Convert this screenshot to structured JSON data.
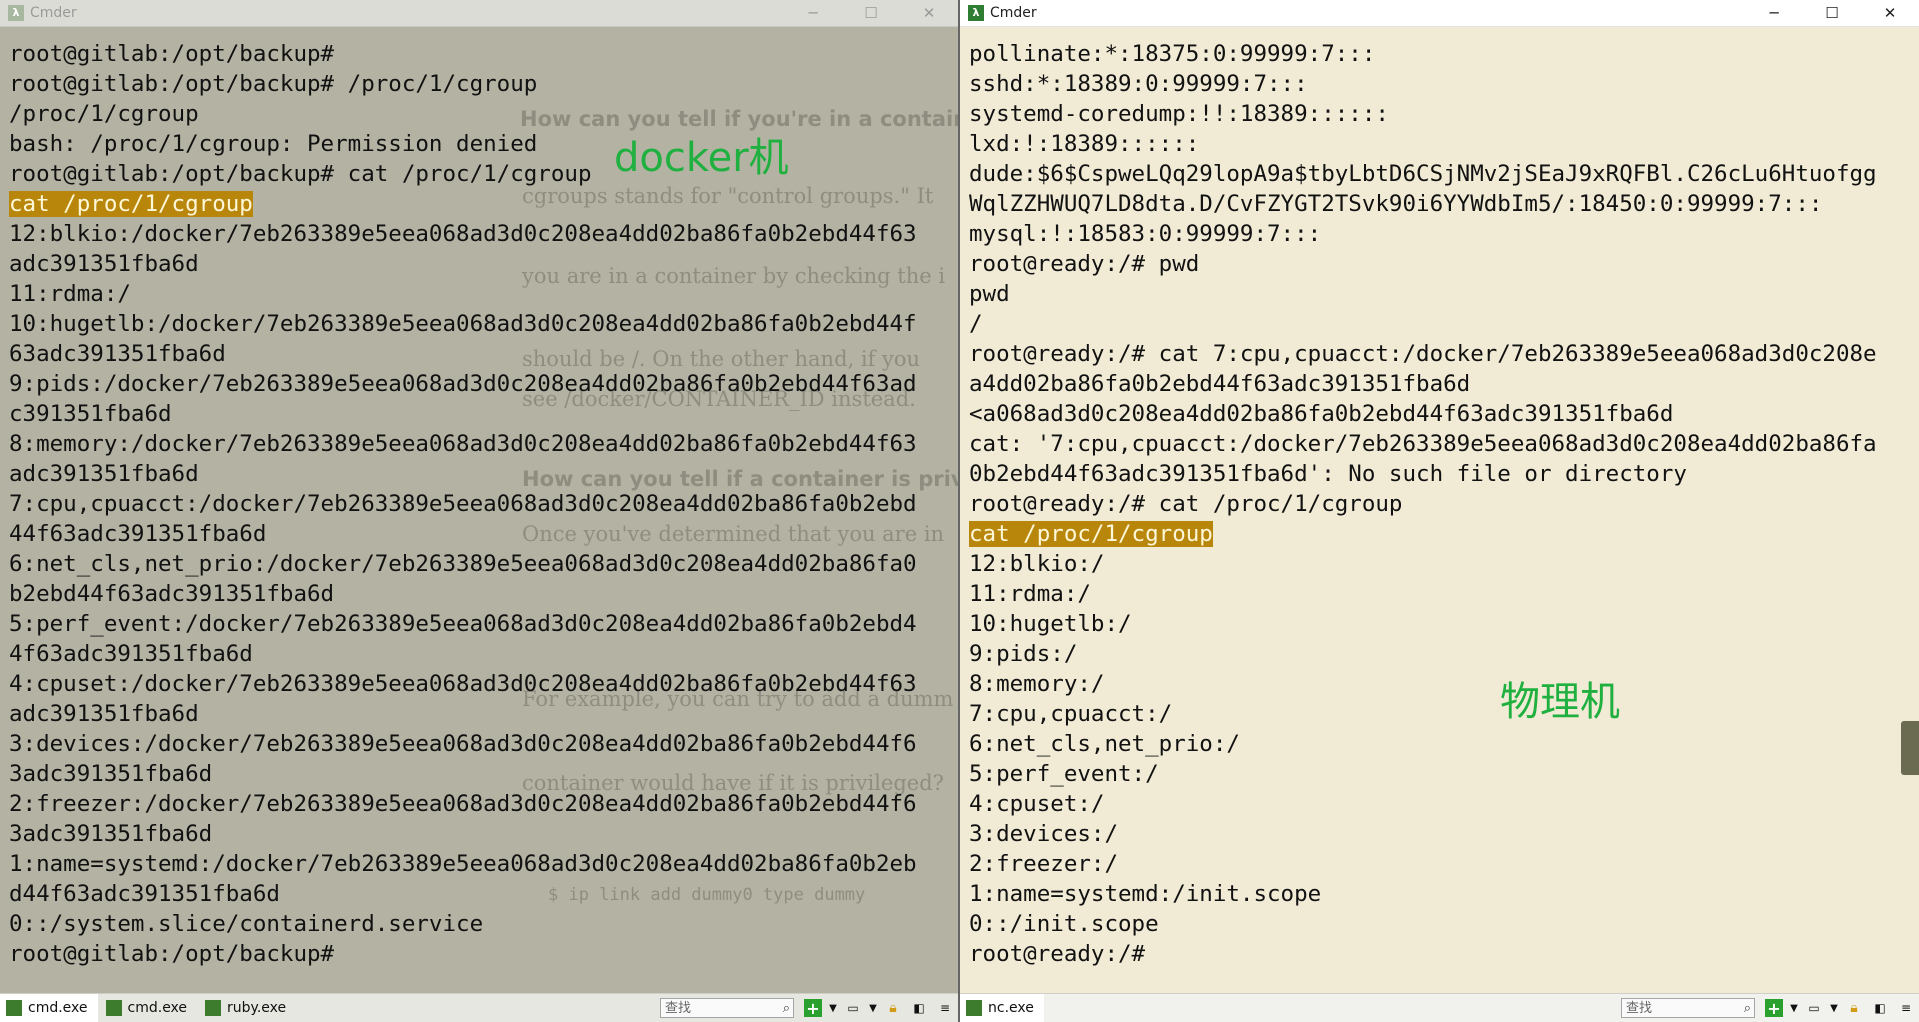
{
  "left_window": {
    "title": "Cmder",
    "overlay_label": "docker机",
    "terminal_lines": [
      "root@gitlab:/opt/backup#",
      "root@gitlab:/opt/backup# /proc/1/cgroup",
      "/proc/1/cgroup",
      "bash: /proc/1/cgroup: Permission denied",
      "root@gitlab:/opt/backup# cat /proc/1/cgroup",
      "cat /proc/1/cgroup",
      "12:blkio:/docker/7eb263389e5eea068ad3d0c208ea4dd02ba86fa0b2ebd44f63",
      "adc391351fba6d",
      "11:rdma:/",
      "10:hugetlb:/docker/7eb263389e5eea068ad3d0c208ea4dd02ba86fa0b2ebd44f",
      "63adc391351fba6d",
      "9:pids:/docker/7eb263389e5eea068ad3d0c208ea4dd02ba86fa0b2ebd44f63ad",
      "c391351fba6d",
      "8:memory:/docker/7eb263389e5eea068ad3d0c208ea4dd02ba86fa0b2ebd44f63",
      "adc391351fba6d",
      "7:cpu,cpuacct:/docker/7eb263389e5eea068ad3d0c208ea4dd02ba86fa0b2ebd",
      "44f63adc391351fba6d",
      "6:net_cls,net_prio:/docker/7eb263389e5eea068ad3d0c208ea4dd02ba86fa0",
      "b2ebd44f63adc391351fba6d",
      "5:perf_event:/docker/7eb263389e5eea068ad3d0c208ea4dd02ba86fa0b2ebd4",
      "4f63adc391351fba6d",
      "4:cpuset:/docker/7eb263389e5eea068ad3d0c208ea4dd02ba86fa0b2ebd44f63",
      "adc391351fba6d",
      "3:devices:/docker/7eb263389e5eea068ad3d0c208ea4dd02ba86fa0b2ebd44f6",
      "3adc391351fba6d",
      "2:freezer:/docker/7eb263389e5eea068ad3d0c208ea4dd02ba86fa0b2ebd44f6",
      "3adc391351fba6d",
      "1:name=systemd:/docker/7eb263389e5eea068ad3d0c208ea4dd02ba86fa0b2eb",
      "d44f63adc391351fba6d",
      "0::/system.slice/containerd.service",
      "root@gitlab:/opt/backup#"
    ],
    "highlighted_line": 5,
    "background_ghost_text": [
      "How can you tell if you're in a contain",
      "cgroups stands for \"control groups.\" It",
      "you are in a container by checking the i",
      "should be  /. On the other hand, if you",
      "see  /docker/CONTAINER_ID  instead.",
      "How can you tell if a container is priv",
      "Once you've determined that you are in",
      "For example, you can try to add a dumm",
      "container would have if it is privileged?",
      "$ ip link add dummy0 type dummy"
    ],
    "tabs": [
      "cmd.exe",
      "cmd.exe",
      "ruby.exe"
    ],
    "active_tab": 0,
    "search_placeholder": "查找"
  },
  "right_window": {
    "title": "Cmder",
    "overlay_label": "物理机",
    "terminal_lines": [
      "pollinate:*:18375:0:99999:7:::",
      "sshd:*:18389:0:99999:7:::",
      "systemd-coredump:!!:18389::::::",
      "lxd:!:18389::::::",
      "dude:$6$CspweLQq29lopA9a$tbyLbtD6CSjNMv2jSEaJ9xRQFBl.C26cLu6Htuofgg",
      "WqlZZHWUQ7LD8dta.D/CvFZYGT2TSvk90i6YYWdbIm5/:18450:0:99999:7:::",
      "mysql:!:18583:0:99999:7:::",
      "root@ready:/# pwd",
      "pwd",
      "/",
      "root@ready:/# cat 7:cpu,cpuacct:/docker/7eb263389e5eea068ad3d0c208e",
      "a4dd02ba86fa0b2ebd44f63adc391351fba6d",
      "<a068ad3d0c208ea4dd02ba86fa0b2ebd44f63adc391351fba6d",
      "cat: '7:cpu,cpuacct:/docker/7eb263389e5eea068ad3d0c208ea4dd02ba86fa",
      "0b2ebd44f63adc391351fba6d': No such file or directory",
      "root@ready:/# cat /proc/1/cgroup",
      "cat /proc/1/cgroup",
      "12:blkio:/",
      "11:rdma:/",
      "10:hugetlb:/",
      "9:pids:/",
      "8:memory:/",
      "7:cpu,cpuacct:/",
      "6:net_cls,net_prio:/",
      "5:perf_event:/",
      "4:cpuset:/",
      "3:devices:/",
      "2:freezer:/",
      "1:name=systemd:/init.scope",
      "0::/init.scope",
      "root@ready:/#"
    ],
    "highlighted_line": 16,
    "tabs": [
      "nc.exe"
    ],
    "active_tab": 0,
    "search_placeholder": "查找"
  },
  "window_controls": {
    "minimize": "─",
    "maximize": "☐",
    "close": "✕"
  },
  "icons": {
    "app": "lambda-icon",
    "search": "magnifier-icon",
    "new_console": "plus-icon",
    "lock": "lock-icon",
    "split_view": "split-icon",
    "menu": "hamburger-icon"
  },
  "colors": {
    "highlight_bg": "#b8860b",
    "label_green": "#20b040",
    "right_bg": "#f1ebd6",
    "left_bg": "#b4b3a3"
  }
}
